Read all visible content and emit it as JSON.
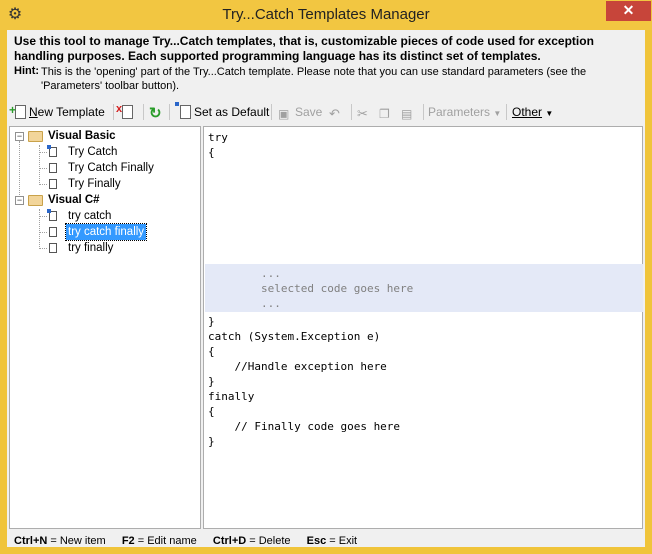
{
  "window": {
    "title": "Try...Catch Templates Manager",
    "close_label": "✕",
    "icon": "gear-icon"
  },
  "description": "Use this tool to manage Try...Catch templates, that is, customizable pieces of code used for exception handling purposes. Each supported programming language has its distinct set of templates.",
  "hint": {
    "label": "Hint:",
    "text": "This is the 'opening' part of the Try...Catch template. Please note that you can use standard parameters (see the 'Parameters' toolbar button)."
  },
  "toolbar": {
    "new_template_prefix": "N",
    "new_template_rest": "ew Template",
    "set_default": "Set as Default",
    "save": "Save",
    "parameters": "Parameters",
    "other": "Other"
  },
  "tree": {
    "groups": [
      {
        "label": "Visual Basic",
        "items": [
          "Try Catch",
          "Try Catch Finally",
          "Try Finally"
        ]
      },
      {
        "label": "Visual C#",
        "items": [
          "try catch",
          "try catch finally",
          "try finally"
        ]
      }
    ],
    "selected": "try catch finally"
  },
  "editor": {
    "lines_top": [
      "try",
      "{"
    ],
    "lines_highlight": [
      "        ...",
      "        selected code goes here",
      "        ..."
    ],
    "lines_bottom": [
      "}",
      "catch (System.Exception e)",
      "{",
      "    //Handle exception here",
      "}",
      "finally",
      "{",
      "    // Finally code goes here",
      "}"
    ]
  },
  "status": {
    "k1": "Ctrl+N",
    "t1": " = New item",
    "k2": "F2",
    "t2": " = Edit name",
    "k3": "Ctrl+D",
    "t3": " = Delete",
    "k4": "Esc",
    "t4": " = Exit"
  },
  "colors": {
    "titlebar": "#f2c641",
    "close": "#c7453a",
    "selection": "#3399ff",
    "code_highlight": "#e4e9f7"
  }
}
